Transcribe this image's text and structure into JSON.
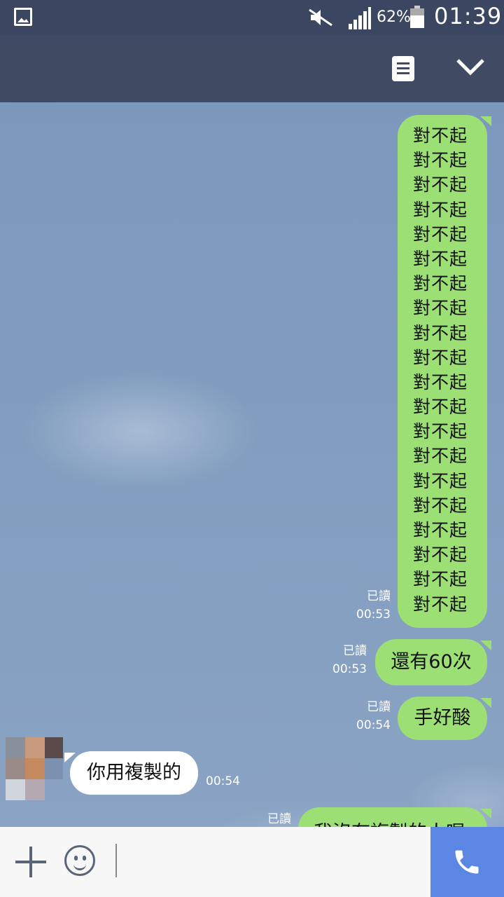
{
  "status_bar": {
    "battery": "62%",
    "time": "01:39"
  },
  "messages": {
    "sorry_block": {
      "lines": [
        "對不起",
        "對不起",
        "對不起",
        "對不起",
        "對不起",
        "對不起",
        "對不起",
        "對不起",
        "對不起",
        "對不起",
        "對不起",
        "對不起",
        "對不起",
        "對不起",
        "對不起",
        "對不起",
        "對不起",
        "對不起",
        "對不起",
        "對不起"
      ],
      "read": "已讀",
      "time": "00:53"
    },
    "sixty_more": {
      "text": "還有60次",
      "read": "已讀",
      "time": "00:53"
    },
    "hand_sore": {
      "text": "手好酸",
      "read": "已讀",
      "time": "00:54"
    },
    "you_copied": {
      "text": "你用複製的",
      "time": "00:54"
    },
    "partial": {
      "text": "我沒有複製的人喔",
      "read": "已讀"
    }
  },
  "colors": {
    "mine_bubble": "#9bdf75",
    "theirs_bubble": "#ffffff",
    "header": "#404a63",
    "call_button": "#5b86e3"
  }
}
